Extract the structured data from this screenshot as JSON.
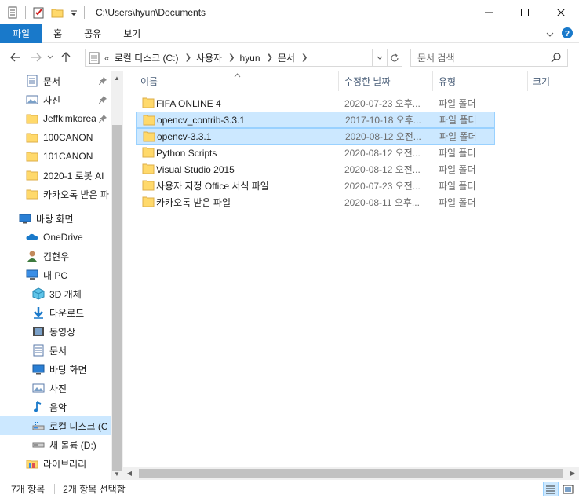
{
  "window": {
    "title": "C:\\Users\\hyun\\Documents",
    "minimize_icon": "minimize-icon",
    "maximize_icon": "maximize-icon",
    "close_icon": "close-icon"
  },
  "ribbon": {
    "tabs": [
      {
        "label": "파일"
      },
      {
        "label": "홈"
      },
      {
        "label": "공유"
      },
      {
        "label": "보기"
      }
    ]
  },
  "address": {
    "prefix": "«",
    "crumbs": [
      "로컬 디스크 (C:)",
      "사용자",
      "hyun",
      "문서"
    ]
  },
  "search": {
    "placeholder": "문서 검색"
  },
  "nav": {
    "quick_access": [
      {
        "label": "문서",
        "icon": "document-icon",
        "pinned": true
      },
      {
        "label": "사진",
        "icon": "pictures-icon",
        "pinned": true
      },
      {
        "label": "Jeffkimkorea",
        "icon": "folder-icon",
        "pinned": true
      },
      {
        "label": "100CANON",
        "icon": "folder-icon",
        "pinned": false
      },
      {
        "label": "101CANON",
        "icon": "folder-icon",
        "pinned": false
      },
      {
        "label": "2020-1 로봇 AI",
        "icon": "folder-icon",
        "pinned": false
      },
      {
        "label": "카카오톡 받은 파",
        "icon": "folder-icon",
        "pinned": false
      }
    ],
    "desktop": "바탕 화면",
    "onedrive": "OneDrive",
    "user": "김현우",
    "this_pc": "내 PC",
    "pc_items": [
      {
        "label": "3D 개체",
        "icon": "3d-objects-icon"
      },
      {
        "label": "다운로드",
        "icon": "downloads-icon"
      },
      {
        "label": "동영상",
        "icon": "videos-icon"
      },
      {
        "label": "문서",
        "icon": "document-icon"
      },
      {
        "label": "바탕 화면",
        "icon": "desktop-icon"
      },
      {
        "label": "사진",
        "icon": "pictures-icon"
      },
      {
        "label": "음악",
        "icon": "music-icon"
      },
      {
        "label": "로컬 디스크 (C",
        "icon": "drive-icon",
        "selected": true
      },
      {
        "label": "새 볼륨 (D:)",
        "icon": "drive-icon"
      }
    ],
    "libraries": "라이브러리"
  },
  "columns": {
    "name": "이름",
    "modified": "수정한 날짜",
    "type": "유형",
    "size": "크기"
  },
  "files": [
    {
      "name": "FIFA ONLINE 4",
      "date": "2020-07-23 오후...",
      "type": "파일 폴더",
      "selected": false
    },
    {
      "name": "opencv_contrib-3.3.1",
      "date": "2017-10-18 오후...",
      "type": "파일 폴더",
      "selected": true
    },
    {
      "name": "opencv-3.3.1",
      "date": "2020-08-12 오전...",
      "type": "파일 폴더",
      "selected": true
    },
    {
      "name": "Python Scripts",
      "date": "2020-08-12 오전...",
      "type": "파일 폴더",
      "selected": false
    },
    {
      "name": "Visual Studio 2015",
      "date": "2020-08-12 오전...",
      "type": "파일 폴더",
      "selected": false
    },
    {
      "name": "사용자 지정 Office 서식 파일",
      "date": "2020-07-23 오전...",
      "type": "파일 폴더",
      "selected": false
    },
    {
      "name": "카카오톡 받은 파일",
      "date": "2020-08-11 오후...",
      "type": "파일 폴더",
      "selected": false
    }
  ],
  "status": {
    "count": "7개 항목",
    "selected": "2개 항목 선택함"
  },
  "colors": {
    "accent": "#1979ca",
    "selection": "#cce8ff",
    "folder": "#ffd96b"
  }
}
